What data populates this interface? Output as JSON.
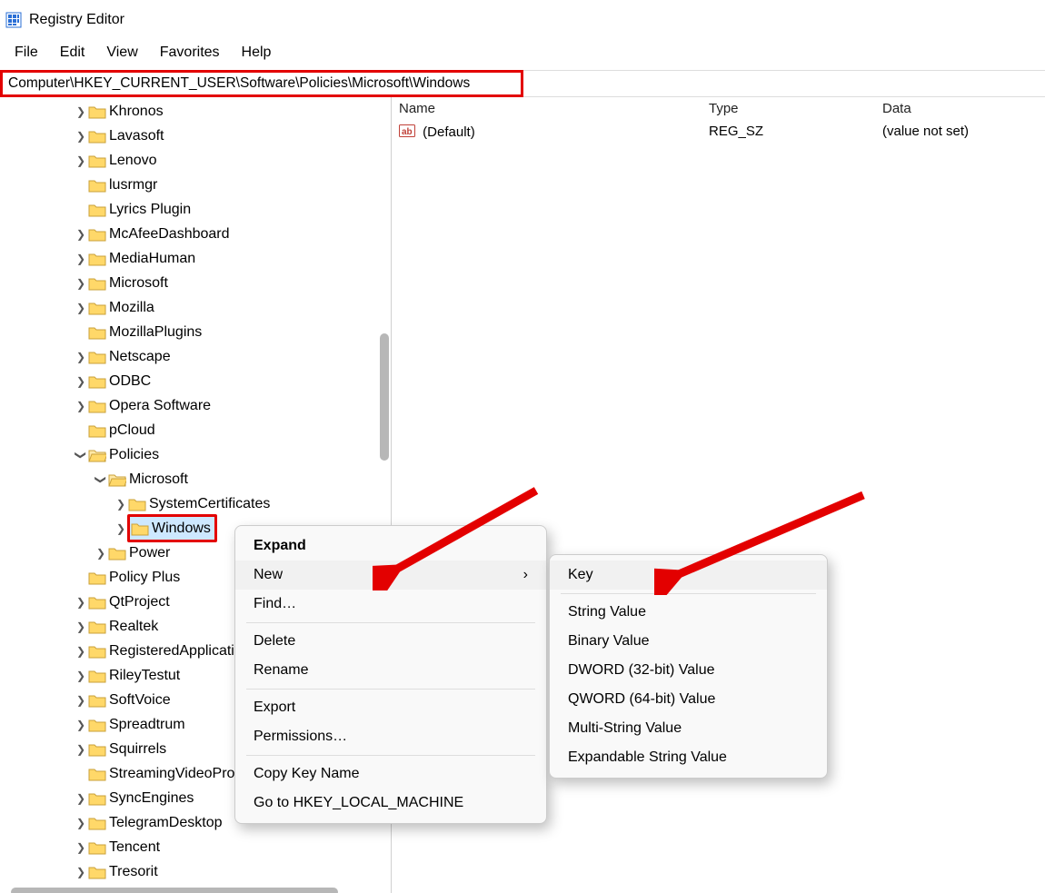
{
  "window": {
    "title": "Registry Editor"
  },
  "menu": {
    "file": "File",
    "edit": "Edit",
    "view": "View",
    "fav": "Favorites",
    "help": "Help"
  },
  "address": "Computer\\HKEY_CURRENT_USER\\Software\\Policies\\Microsoft\\Windows",
  "tree": {
    "l0": [
      {
        "exp": ">",
        "name": "Khronos"
      },
      {
        "exp": ">",
        "name": "Lavasoft"
      },
      {
        "exp": ">",
        "name": "Lenovo"
      },
      {
        "exp": "",
        "name": "lusrmgr"
      },
      {
        "exp": "",
        "name": "Lyrics Plugin"
      },
      {
        "exp": ">",
        "name": "McAfeeDashboard"
      },
      {
        "exp": ">",
        "name": "MediaHuman"
      },
      {
        "exp": ">",
        "name": "Microsoft"
      },
      {
        "exp": ">",
        "name": "Mozilla"
      },
      {
        "exp": "",
        "name": "MozillaPlugins"
      },
      {
        "exp": ">",
        "name": "Netscape"
      },
      {
        "exp": ">",
        "name": "ODBC"
      },
      {
        "exp": ">",
        "name": "Opera Software"
      },
      {
        "exp": "",
        "name": "pCloud"
      }
    ],
    "policies": {
      "exp": "v",
      "name": "Policies"
    },
    "microsoft": {
      "exp": "v",
      "name": "Microsoft"
    },
    "syscert": {
      "exp": ">",
      "name": "SystemCertificates"
    },
    "windows": {
      "exp": ">",
      "name": "Windows"
    },
    "power": {
      "exp": ">",
      "name": "Power"
    },
    "l1": [
      {
        "exp": "",
        "name": "Policy Plus"
      },
      {
        "exp": ">",
        "name": "QtProject"
      },
      {
        "exp": ">",
        "name": "Realtek"
      },
      {
        "exp": ">",
        "name": "RegisteredApplications"
      },
      {
        "exp": ">",
        "name": "RileyTestut"
      },
      {
        "exp": ">",
        "name": "SoftVoice"
      },
      {
        "exp": ">",
        "name": "Spreadtrum"
      },
      {
        "exp": ">",
        "name": "Squirrels"
      },
      {
        "exp": "",
        "name": "StreamingVideoProvider"
      },
      {
        "exp": ">",
        "name": "SyncEngines"
      },
      {
        "exp": ">",
        "name": "TelegramDesktop"
      },
      {
        "exp": ">",
        "name": "Tencent"
      },
      {
        "exp": ">",
        "name": "Tresorit"
      }
    ]
  },
  "list": {
    "cols": {
      "name": "Name",
      "type": "Type",
      "data": "Data"
    },
    "rows": [
      {
        "name": "(Default)",
        "type": "REG_SZ",
        "data": "(value not set)"
      }
    ]
  },
  "ctx1": {
    "expand": "Expand",
    "new": "New",
    "find": "Find…",
    "delete": "Delete",
    "rename": "Rename",
    "export": "Export",
    "perm": "Permissions…",
    "copy": "Copy Key Name",
    "goto": "Go to HKEY_LOCAL_MACHINE"
  },
  "ctx2": {
    "key": "Key",
    "str": "String Value",
    "bin": "Binary Value",
    "dword": "DWORD (32-bit) Value",
    "qword": "QWORD (64-bit) Value",
    "multi": "Multi-String Value",
    "expand": "Expandable String Value"
  },
  "glyph": {
    "right": "›",
    "submenu": "›"
  }
}
